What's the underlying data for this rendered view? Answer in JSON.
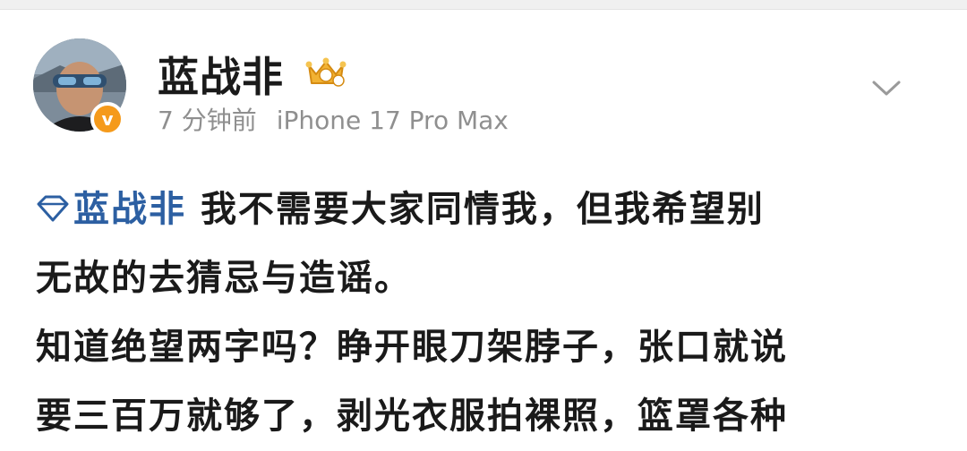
{
  "post": {
    "author": {
      "name": "蓝战非",
      "verified_mark": "v",
      "level_icon": "crown-badge-icon"
    },
    "meta": {
      "time": "7 分钟前",
      "device": "iPhone 17 Pro Max"
    },
    "menu_icon": "chevron-down-icon",
    "content": {
      "mention": "蓝战非",
      "mention_icon": "diamond-icon",
      "lines": [
        "我不需要大家同情我，但我希望别",
        "无故的去猜忌与造谣。",
        "知道绝望两字吗？睁开眼刀架脖子，张口就说",
        "要三百万就够了，剥光衣服拍裸照，篮罩各种"
      ]
    }
  },
  "colors": {
    "link": "#2c5fa2",
    "meta": "#8f8f8f",
    "verified": "#f59a1b",
    "crown": "#e8a317"
  }
}
